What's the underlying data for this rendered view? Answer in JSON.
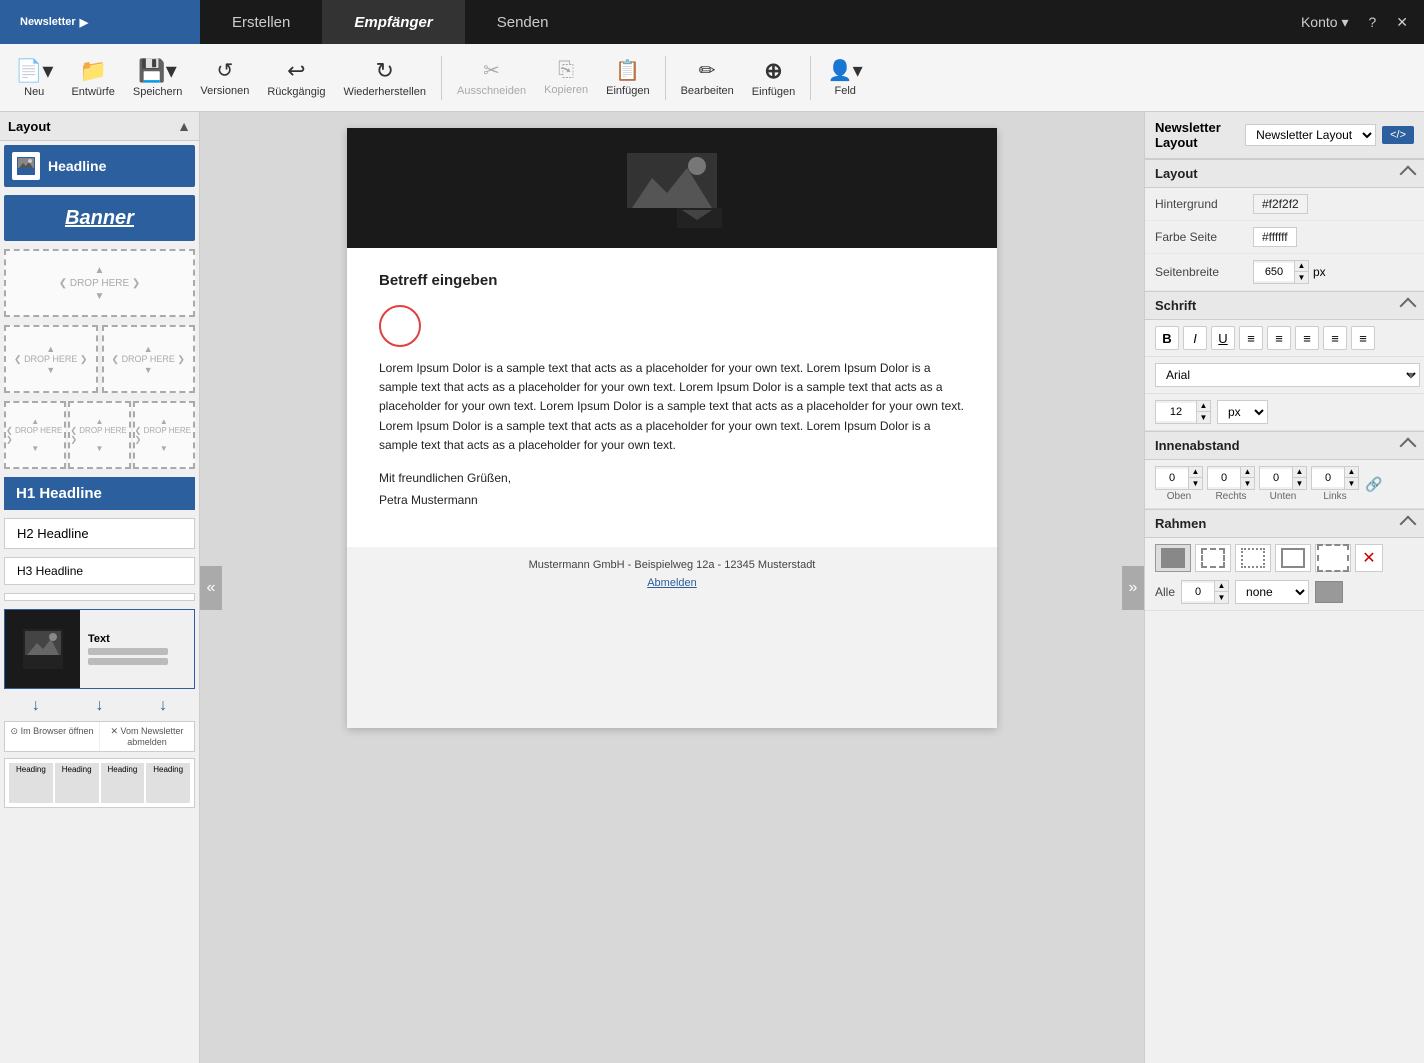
{
  "nav": {
    "brand": "Newsletter",
    "brand_arrow": "▶",
    "tabs": [
      {
        "label": "Erstellen",
        "active": false
      },
      {
        "label": "Empfänger",
        "active": true
      },
      {
        "label": "Senden",
        "active": false
      }
    ],
    "right": {
      "konto": "Konto",
      "konto_arrow": "▾",
      "help": "?",
      "close": "✕"
    }
  },
  "toolbar": {
    "buttons": [
      {
        "label": "Neu",
        "icon": "📄",
        "dropdown": true,
        "disabled": false
      },
      {
        "label": "Entwürfe",
        "icon": "📁",
        "disabled": false
      },
      {
        "label": "Speichern",
        "icon": "💾",
        "dropdown": true,
        "disabled": false
      },
      {
        "label": "Versionen",
        "icon": "↺",
        "disabled": false
      },
      {
        "label": "Rückgängig",
        "icon": "↩",
        "disabled": false
      },
      {
        "label": "Wiederherstellen",
        "icon": "↻",
        "disabled": false
      },
      {
        "label": "Ausschneiden",
        "icon": "✂",
        "disabled": true
      },
      {
        "label": "Kopieren",
        "icon": "⎘",
        "disabled": true
      },
      {
        "label": "Einfügen",
        "icon": "📋",
        "disabled": false
      },
      {
        "label": "Bearbeiten",
        "icon": "✏",
        "disabled": false
      },
      {
        "label": "Einfügen",
        "icon": "⊕",
        "disabled": false
      },
      {
        "label": "Feld",
        "icon": "👤",
        "dropdown": true,
        "disabled": false
      }
    ]
  },
  "left_panel": {
    "header": "Layout",
    "items": {
      "headline_label": "Headline",
      "banner_label": "Banner",
      "drop_here": "DROP HERE",
      "h1_label": "H1 Headline",
      "h2_label": "H2 Headline",
      "h3_label": "H3 Headline",
      "text_label": "Text",
      "line1": "—",
      "line2": "—",
      "line3": "—"
    },
    "link_bar_labels": [
      "Im Browser öffnen",
      "Vom Newsletter abmelden"
    ]
  },
  "canvas": {
    "collapse_left": "«",
    "collapse_right": "»",
    "email": {
      "subject": "Betreff eingeben",
      "body_text": "Lorem Ipsum Dolor is a sample text that acts as a placeholder for your own text. Lorem Ipsum Dolor is a sample text that acts as a placeholder for your own text. Lorem Ipsum Dolor is a sample text that acts as a placeholder for your own text. Lorem Ipsum Dolor is a sample text that acts as a placeholder for your own text. Lorem Ipsum Dolor is a sample text that acts as a placeholder for your own text. Lorem Ipsum Dolor is a sample text that acts as a placeholder for your own text.",
      "greeting": "Mit freundlichen Grüßen,",
      "name": "Petra Mustermann",
      "footer_address": "Mustermann GmbH - Beispielweg 12a - 12345 Musterstadt",
      "unsubscribe": "Abmelden"
    }
  },
  "right_panel": {
    "title": "Newsletter Layout",
    "dropdown_arrow": "▾",
    "code_btn": "</>",
    "sections": {
      "layout": {
        "label": "Layout",
        "hintergrund_label": "Hintergrund",
        "hintergrund_value": "#f2f2f2",
        "farbe_label": "Farbe Seite",
        "farbe_value": "#ffffff",
        "breite_label": "Seitenbreite",
        "breite_value": "650",
        "breite_unit": "px"
      },
      "schrift": {
        "label": "Schrift",
        "bold": "B",
        "italic": "I",
        "underline": "U",
        "align_left": "≡",
        "align_center": "≡",
        "align_right": "≡",
        "align_justify": "≡",
        "list": "≡",
        "font_name": "Arial",
        "font_size": "12",
        "font_unit": "px"
      },
      "innenabstand": {
        "label": "Innenabstand",
        "oben": "0",
        "rechts": "0",
        "unten": "0",
        "links": "0",
        "oben_label": "Oben",
        "rechts_label": "Rechts",
        "unten_label": "Unten",
        "links_label": "Links"
      },
      "rahmen": {
        "label": "Rahmen",
        "alle_label": "Alle",
        "alle_value": "0",
        "style": "none",
        "color": "#999999"
      }
    }
  }
}
